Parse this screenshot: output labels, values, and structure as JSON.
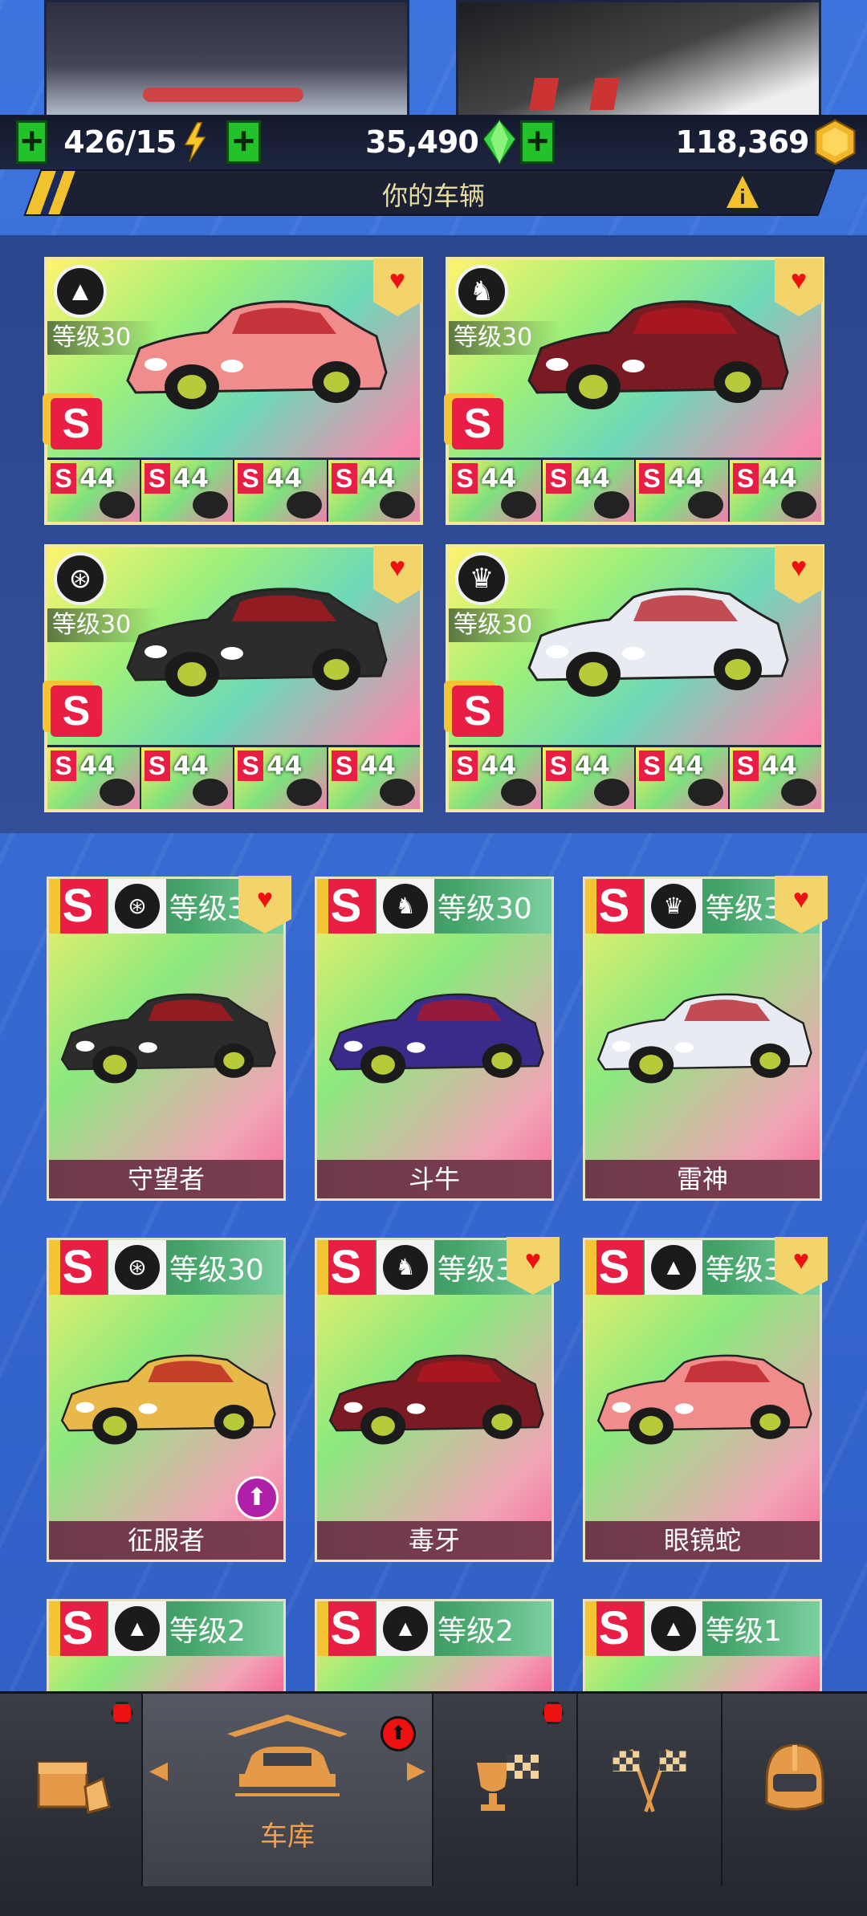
{
  "resources": {
    "energy": "426/15",
    "gems": "35,490",
    "coins": "118,369"
  },
  "title": "你的车辆",
  "favorites": [
    {
      "level": "等级30",
      "class_icon": "road-icon",
      "rank": "S",
      "parts": [
        "44",
        "44",
        "44",
        "44"
      ],
      "color": "#f08c8c"
    },
    {
      "level": "等级30",
      "class_icon": "horse-icon",
      "rank": "S",
      "parts": [
        "44",
        "44",
        "44",
        "44"
      ],
      "color": "#7a1b24"
    },
    {
      "level": "等级30",
      "class_icon": "wheel-icon",
      "rank": "S",
      "parts": [
        "44",
        "44",
        "44",
        "44"
      ],
      "color": "#2c2c2c"
    },
    {
      "level": "等级30",
      "class_icon": "crown-icon",
      "rank": "S",
      "parts": [
        "44",
        "44",
        "44",
        "44"
      ],
      "color": "#e8ecf2"
    }
  ],
  "cars": [
    {
      "level": "等级3",
      "name": "守望者",
      "class_icon": "wheel-icon",
      "heart": true,
      "color": "#2c2c2c"
    },
    {
      "level": "等级30",
      "name": "斗牛",
      "class_icon": "horse-icon",
      "heart": false,
      "color": "#3a2a8a"
    },
    {
      "level": "等级3",
      "name": "雷神",
      "class_icon": "crown-icon",
      "heart": true,
      "color": "#e8ecf2"
    },
    {
      "level": "等级30",
      "name": "征服者",
      "class_icon": "wheel-icon",
      "heart": false,
      "color": "#e8b84a",
      "upgrade": true
    },
    {
      "level": "等级3",
      "name": "毒牙",
      "class_icon": "horse-icon",
      "heart": true,
      "color": "#7a1b24"
    },
    {
      "level": "等级3",
      "name": "眼镜蛇",
      "class_icon": "road-icon",
      "heart": true,
      "color": "#f08c8c"
    },
    {
      "level": "等级2",
      "name": "",
      "class_icon": "road-icon",
      "heart": false
    },
    {
      "level": "等级2",
      "name": "",
      "class_icon": "road-icon",
      "heart": false
    },
    {
      "level": "等级1",
      "name": "",
      "class_icon": "road-icon",
      "heart": false
    }
  ],
  "nav": {
    "garage_label": "车库"
  },
  "accent": "#e59a4a"
}
